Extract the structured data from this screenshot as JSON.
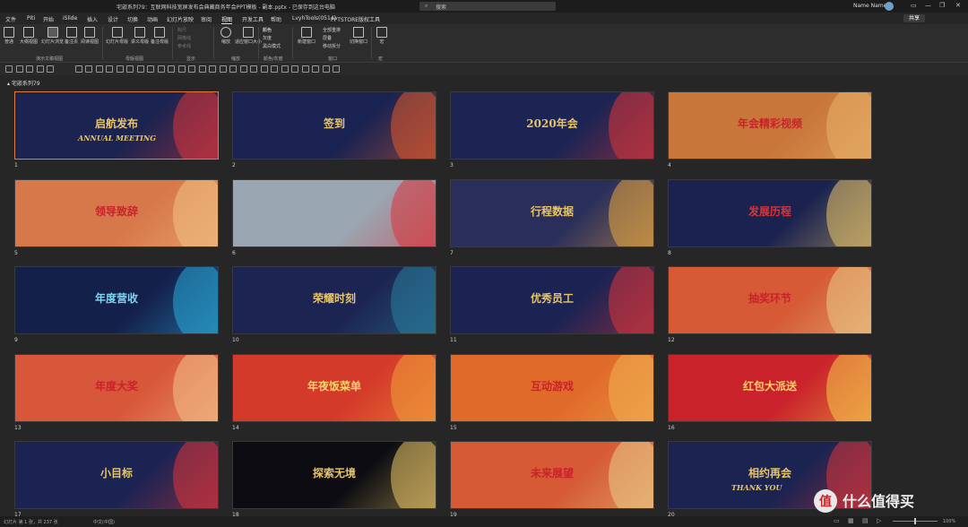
{
  "titlebar": {
    "document": "宅嵌系列79：互联网科技宽屏发布会典藏商务年会PPT模板 - 副本.pptx - 已保存到这台电脑",
    "search_placeholder": "搜索",
    "user_name": "Name Name"
  },
  "menu": {
    "items": [
      "文件",
      "Piti",
      "开始",
      "iSlide",
      "插入",
      "设计",
      "切换",
      "动画",
      "幻灯片放映",
      "审阅",
      "视图",
      "开发工具",
      "帮助",
      "LvyhTools(0514)",
      "PPTSTORE版权工具"
    ],
    "active_index": 10,
    "share_label": "共享"
  },
  "ribbon": {
    "presentation_views": [
      "普通",
      "大纲视图",
      "幻灯片浏览",
      "备注页",
      "阅读视图"
    ],
    "master_views": [
      "幻灯片母版",
      "讲义母版",
      "备注母版"
    ],
    "show_options": [
      "标尺",
      "网格线",
      "参考线"
    ],
    "zoom": [
      "缩放",
      "适应窗口大小"
    ],
    "color": [
      "颜色",
      "灰度",
      "黑白模式"
    ],
    "window": [
      "新建窗口",
      "全部重排",
      "层叠",
      "移动拆分"
    ],
    "switch_window": "切换窗口",
    "macro": "宏",
    "group_labels": [
      "演示文稿视图",
      "母版视图",
      "显示",
      "缩放",
      "颜色/灰度",
      "窗口",
      "宏"
    ]
  },
  "section_name": "宅嵌系列79",
  "slides": [
    {
      "n": "1",
      "title": "启航发布",
      "sub": "ANNUAL MEETING",
      "bg": "#1b2350",
      "accent": "#d8343a",
      "tc": "#e8c468"
    },
    {
      "n": "2",
      "title": "签到",
      "sub": "",
      "bg": "#1a2352",
      "accent": "#e05a2a",
      "tc": "#e8c468"
    },
    {
      "n": "3",
      "title": "2020年会",
      "sub": "",
      "bg": "#1b2452",
      "accent": "#d8343a",
      "tc": "#e8c468"
    },
    {
      "n": "4",
      "title": "年会精彩视频",
      "sub": "",
      "bg": "#c9763a",
      "accent": "#e8b36a",
      "tc": "#c9222a"
    },
    {
      "n": "5",
      "title": "领导致辞",
      "sub": "",
      "bg": "#d7784b",
      "accent": "#f1c184",
      "tc": "#c9222a"
    },
    {
      "n": "6",
      "title": "",
      "sub": "",
      "bg": "#9aa7b3",
      "accent": "#d8343a",
      "tc": "#c9222a"
    },
    {
      "n": "7",
      "title": "行程数据",
      "sub": "",
      "bg": "#2a2e5a",
      "accent": "#e8a640",
      "tc": "#e8c468"
    },
    {
      "n": "8",
      "title": "发展历程",
      "sub": "",
      "bg": "#1a2250",
      "accent": "#e8c468",
      "tc": "#d8343a"
    },
    {
      "n": "9",
      "title": "年度营收",
      "sub": "",
      "bg": "#13204a",
      "accent": "#2aa9d8",
      "tc": "#7fd2f0"
    },
    {
      "n": "10",
      "title": "荣耀时刻",
      "sub": "",
      "bg": "#1c2452",
      "accent": "#2a7f9a",
      "tc": "#e8c468"
    },
    {
      "n": "11",
      "title": "优秀员工",
      "sub": "",
      "bg": "#1b2352",
      "accent": "#d8343a",
      "tc": "#e8c468"
    },
    {
      "n": "12",
      "title": "抽奖环节",
      "sub": "",
      "bg": "#d55a35",
      "accent": "#eacb86",
      "tc": "#c9222a"
    },
    {
      "n": "13",
      "title": "年度大奖",
      "sub": "",
      "bg": "#d8563a",
      "accent": "#f2c18a",
      "tc": "#c9222a"
    },
    {
      "n": "14",
      "title": "年夜饭菜单",
      "sub": "",
      "bg": "#d43a2a",
      "accent": "#f0a03a",
      "tc": "#f5d36a"
    },
    {
      "n": "15",
      "title": "互动游戏",
      "sub": "",
      "bg": "#e06a2a",
      "accent": "#f0b050",
      "tc": "#c9222a"
    },
    {
      "n": "16",
      "title": "红包大派送",
      "sub": "",
      "bg": "#c9222a",
      "accent": "#f5c84a",
      "tc": "#f5d36a"
    },
    {
      "n": "17",
      "title": "小目标",
      "sub": "",
      "bg": "#1b2352",
      "accent": "#d8343a",
      "tc": "#e8c468"
    },
    {
      "n": "18",
      "title": "探索无境",
      "sub": "",
      "bg": "#0c0c12",
      "accent": "#e8c468",
      "tc": "#e8c468"
    },
    {
      "n": "19",
      "title": "未来展望",
      "sub": "",
      "bg": "#d55a35",
      "accent": "#eacb86",
      "tc": "#c9222a"
    },
    {
      "n": "20",
      "title": "相约再会",
      "sub": "THANK YOU",
      "bg": "#1b2350",
      "accent": "#d8343a",
      "tc": "#e8c468"
    }
  ],
  "status": {
    "slide_info": "幻灯片 第 1 张，共 237 张",
    "language": "中文(中国)",
    "zoom_level": "100%"
  },
  "watermark": "值 什么值得买"
}
